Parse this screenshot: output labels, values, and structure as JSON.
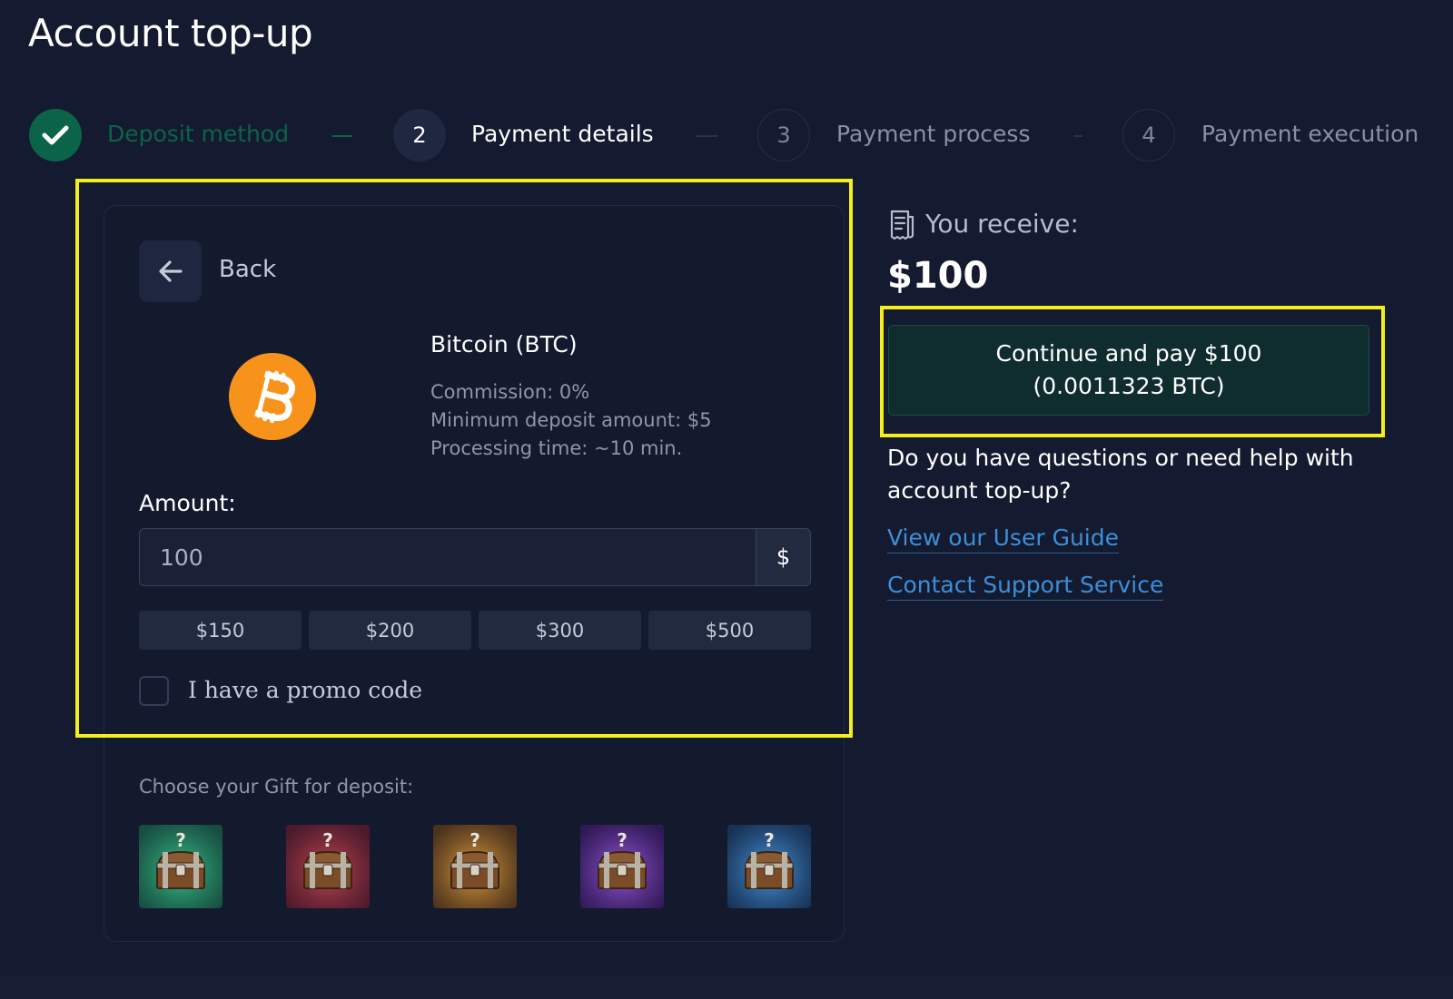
{
  "page": {
    "title": "Account top-up"
  },
  "stepper": {
    "steps": [
      {
        "number": "",
        "label": "Deposit method",
        "state": "done"
      },
      {
        "number": "2",
        "label": "Payment details",
        "state": "active"
      },
      {
        "number": "3",
        "label": "Payment process",
        "state": "todo"
      },
      {
        "number": "4",
        "label": "Payment execution",
        "state": "todo"
      }
    ]
  },
  "card": {
    "back_label": "Back",
    "method": {
      "name": "Bitcoin (BTC)",
      "commission": "Commission: 0%",
      "min_deposit": "Minimum deposit amount: $5",
      "processing_time": "Processing time: ~10 min."
    },
    "amount": {
      "label": "Amount:",
      "value": "100",
      "currency_symbol": "$",
      "presets": [
        "$150",
        "$200",
        "$300",
        "$500"
      ]
    },
    "promo": {
      "label": "I have a promo code",
      "checked": false
    },
    "gifts": {
      "label": "Choose your Gift for deposit:",
      "items": [
        {
          "color": "#1e7a55",
          "glow": "#37c48a"
        },
        {
          "color": "#7a1e2c",
          "glow": "#c24a57"
        },
        {
          "color": "#7a4a14",
          "glow": "#e0a040"
        },
        {
          "color": "#4a1e7a",
          "glow": "#9a5ae0"
        },
        {
          "color": "#1e4a7a",
          "glow": "#4a9ae0"
        }
      ]
    }
  },
  "summary": {
    "receive_label": "You receive:",
    "receive_amount": "$100",
    "pay_button_line1": "Continue and pay $100",
    "pay_button_line2": "(0.0011323 BTC)",
    "help_text": "Do you have questions or need help with account top-up?",
    "links": [
      "View our User Guide",
      "Contact Support Service"
    ]
  },
  "colors": {
    "background": "#141a2f",
    "success": "#0b6448",
    "highlight": "#f4ef1a",
    "bitcoin": "#f7931a",
    "link": "#3c8fd8"
  }
}
